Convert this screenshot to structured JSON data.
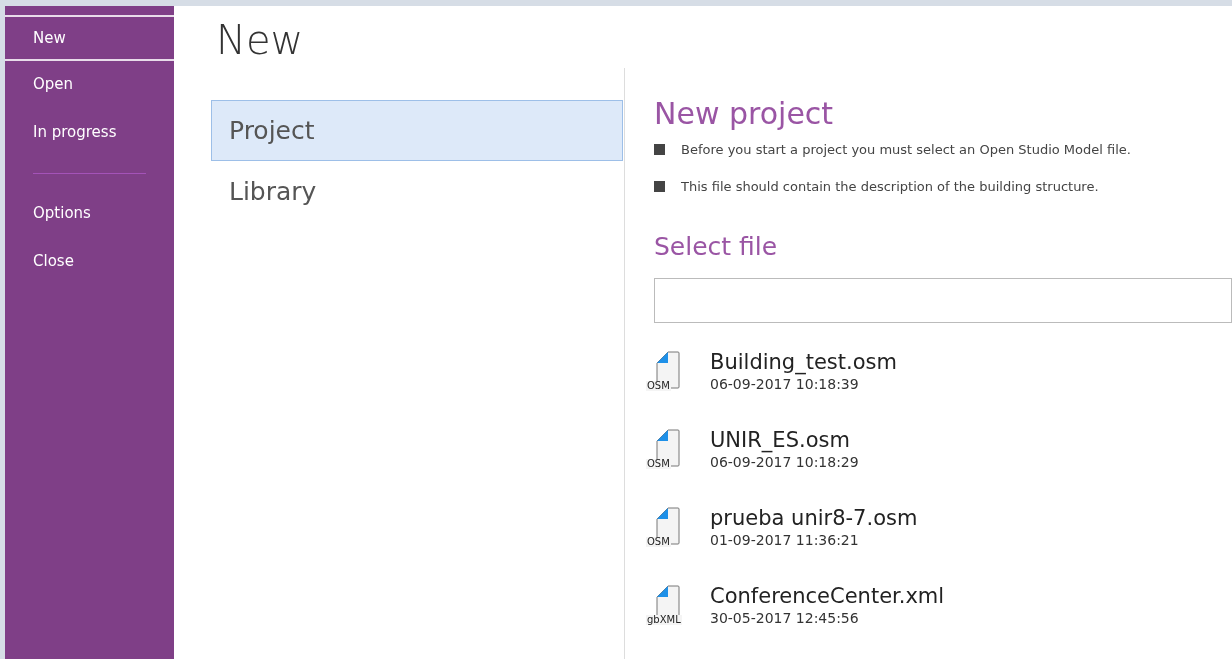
{
  "sidebar": {
    "groups": [
      {
        "items": [
          {
            "label": "New",
            "selected": true
          },
          {
            "label": "Open",
            "selected": false
          },
          {
            "label": "In progress",
            "selected": false
          }
        ]
      },
      {
        "items": [
          {
            "label": "Options",
            "selected": false
          },
          {
            "label": "Close",
            "selected": false
          }
        ]
      }
    ]
  },
  "page_title": "New",
  "categories": [
    {
      "label": "Project",
      "selected": true
    },
    {
      "label": "Library",
      "selected": false
    }
  ],
  "panel": {
    "title": "New project",
    "bullets": [
      "Before you start a project you must select an Open Studio Model file.",
      "This file should contain the description of the building structure."
    ],
    "select_title": "Select file",
    "files": [
      {
        "badge": "OSM",
        "name": "Building_test.osm",
        "date": "06-09-2017 10:18:39"
      },
      {
        "badge": "OSM",
        "name": "UNIR_ES.osm",
        "date": "06-09-2017 10:18:29"
      },
      {
        "badge": "OSM",
        "name": "prueba unir8-7.osm",
        "date": "01-09-2017 11:36:21"
      },
      {
        "badge": "gbXML",
        "name": "ConferenceCenter.xml",
        "date": "30-05-2017 12:45:56"
      }
    ]
  }
}
